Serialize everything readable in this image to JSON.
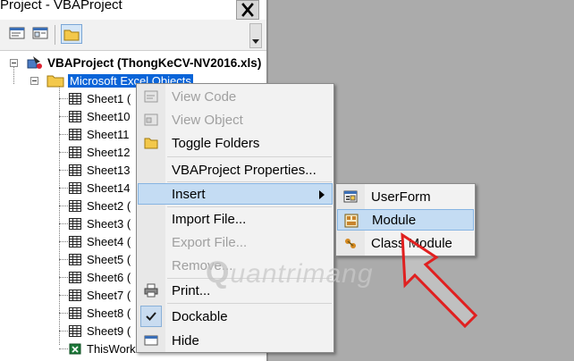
{
  "window": {
    "title": "Project - VBAProject",
    "close_glyph": "✕"
  },
  "toolbar": {
    "buttons": [
      {
        "icon": "view-code-icon"
      },
      {
        "icon": "view-object-icon"
      },
      {
        "icon": "toggle-folders-icon",
        "active": true
      }
    ]
  },
  "tree": {
    "project_label": "VBAProject (ThongKeCV-NV2016.xls)",
    "folder_label": "Microsoft Excel Objects",
    "items": [
      {
        "label": "Sheet1 ("
      },
      {
        "label": "Sheet10"
      },
      {
        "label": "Sheet11"
      },
      {
        "label": "Sheet12"
      },
      {
        "label": "Sheet13"
      },
      {
        "label": "Sheet14"
      },
      {
        "label": "Sheet2 ("
      },
      {
        "label": "Sheet3 ("
      },
      {
        "label": "Sheet4 ("
      },
      {
        "label": "Sheet5 ("
      },
      {
        "label": "Sheet6 ("
      },
      {
        "label": "Sheet7 ("
      },
      {
        "label": "Sheet8 ("
      },
      {
        "label": "Sheet9 ("
      },
      {
        "label": "ThisWork"
      }
    ]
  },
  "context_menu": {
    "items": [
      {
        "label": "View Code",
        "disabled": true,
        "icon": "view-code-icon"
      },
      {
        "label": "View Object",
        "disabled": true,
        "icon": "view-object-icon"
      },
      {
        "label": "Toggle Folders",
        "disabled": false,
        "icon": "folder-icon"
      },
      {
        "label": "VBAProject Properties...",
        "disabled": false
      },
      {
        "label": "Insert",
        "disabled": false,
        "hover": true,
        "has_submenu": true
      },
      {
        "label": "Import File...",
        "disabled": false
      },
      {
        "label": "Export File...",
        "disabled": true
      },
      {
        "label": "Remove...",
        "disabled": true
      },
      {
        "label": "Print...",
        "disabled": false,
        "icon": "printer-icon"
      },
      {
        "label": "Dockable",
        "disabled": false,
        "checked": true,
        "icon": "checkmark-icon"
      },
      {
        "label": "Hide",
        "disabled": false,
        "icon": "hide-icon"
      }
    ]
  },
  "insert_submenu": {
    "items": [
      {
        "label": "UserForm",
        "icon": "userform-icon"
      },
      {
        "label": "Module",
        "icon": "module-icon",
        "hover": true
      },
      {
        "label": "Class Module",
        "icon": "class-module-icon"
      }
    ]
  },
  "watermark": {
    "text": "uantrimang"
  },
  "colors": {
    "selection": "#0a64d8",
    "menu_hover": "#c4dcf3",
    "arrow": "#e02020",
    "background": "#ababab"
  }
}
